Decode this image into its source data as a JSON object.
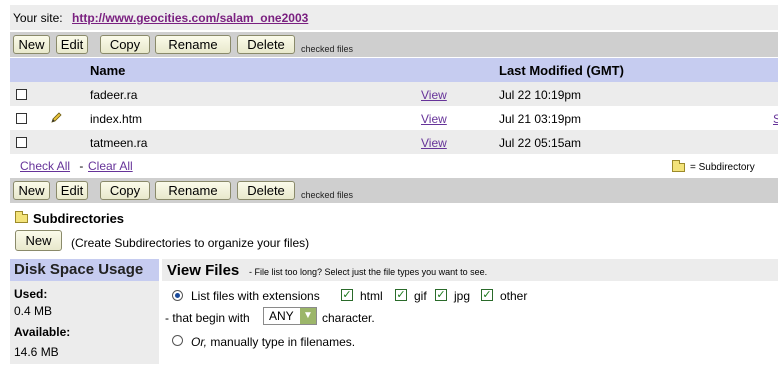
{
  "site": {
    "label": "Your site:",
    "url": "http://www.geocities.com/salam_one2003"
  },
  "toolbar": {
    "new": "New",
    "edit": "Edit",
    "copy": "Copy",
    "rename": "Rename",
    "delete": "Delete",
    "note": "checked files"
  },
  "table": {
    "headers": {
      "name": "Name",
      "modified": "Last Modified (GMT)"
    },
    "rows": [
      {
        "name": "fadeer.ra",
        "view": "View",
        "modified": "Jul 22 10:19pm",
        "editable": false
      },
      {
        "name": "index.htm",
        "view": "View",
        "modified": "Jul 21 03:19pm",
        "editable": true
      },
      {
        "name": "tatmeen.ra",
        "view": "View",
        "modified": "Jul 22 05:15am",
        "editable": false
      }
    ],
    "edge_text": "S"
  },
  "selection": {
    "check_all": "Check All",
    "separator": " - ",
    "clear_all": "Clear All"
  },
  "legend": {
    "subdirectory": "= Subdirectory"
  },
  "subdirectories": {
    "title": "Subdirectories",
    "new": "New",
    "hint": "(Create Subdirectories to organize your files)"
  },
  "disk": {
    "title": "Disk Space Usage",
    "used_label": "Used:",
    "used_value": "0.4 MB",
    "available_label": "Available:",
    "available_value": "14.6 MB"
  },
  "view_files": {
    "title": "View Files",
    "hint": "- File list too long? Select just the file types you want to see.",
    "option1": "List files with extensions",
    "extensions": [
      "html",
      "gif",
      "jpg",
      "other"
    ],
    "begin_prefix": "- that begin with",
    "begin_value": "ANY",
    "begin_suffix": "character.",
    "option2_em": "Or,",
    "option2_rest": " manually type in filenames."
  },
  "colors": {
    "header_bg": "#c6ccf0",
    "toolbar_bg": "#cfcfcf",
    "link": "#663399",
    "url": "#7a2080"
  }
}
